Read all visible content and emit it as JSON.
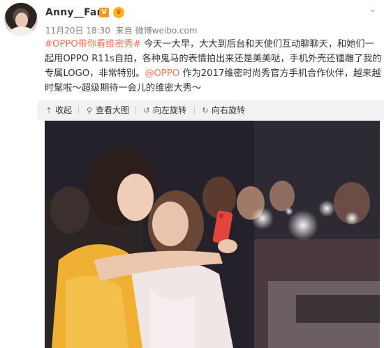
{
  "post": {
    "user_name": "Anny__Fan",
    "vip_badge": "V",
    "crown_badge": "♛",
    "date": "11月20日 18:30",
    "source_prefix": "来自",
    "source": "微博weibo.com",
    "content": {
      "topic": "#OPPO带你看维密秀#",
      "text_1": " 今天一大早，大大到后台和天使们互动聊聊天，和她们一起用OPPO R11s自拍，各种鬼马的表情拍出来还是美美哒，手机外壳还镭雕了我的专属LOGO，非常特别。",
      "mention": "@OPPO",
      "text_2": " 作为2017维密时尚秀官方手机合作伙伴，越来越时髦啦～超级期待一会儿的维密大秀～"
    }
  },
  "toolbar": {
    "collapse": "收起",
    "view_large": "查看大图",
    "rotate_left": "向左旋转",
    "rotate_right": "向右旋转"
  },
  "icons": {
    "collapse": "arrow-up-icon",
    "view_large": "magnifier-icon",
    "rotate_left": "rotate-left-icon",
    "rotate_right": "rotate-right-icon",
    "menu": "chevron-down-icon"
  },
  "colors": {
    "link": "#eb7350",
    "toolbar_bg": "#f2f2f5",
    "vip": "#f7981c"
  }
}
